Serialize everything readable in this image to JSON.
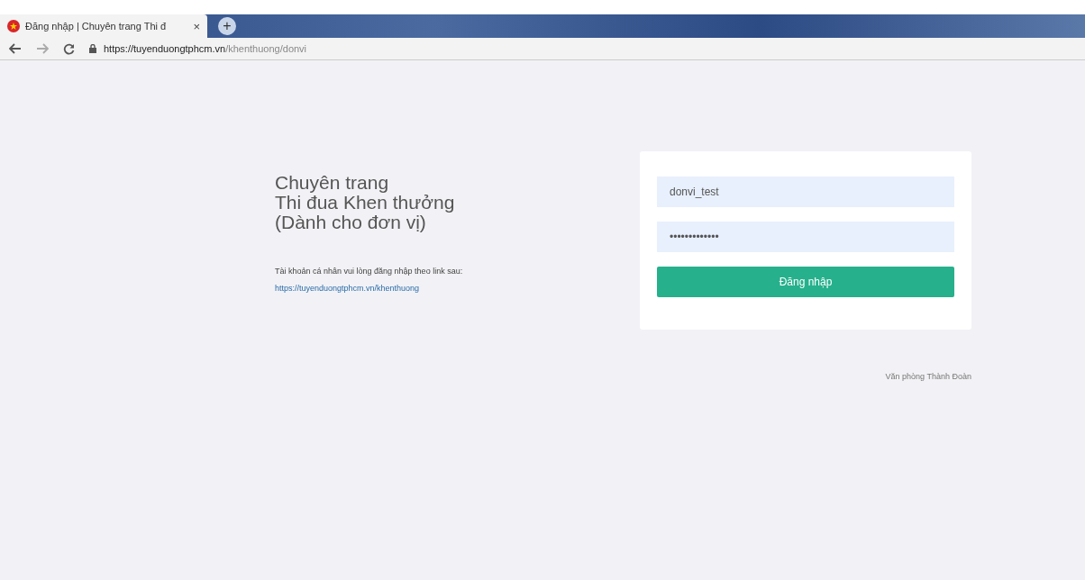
{
  "browser": {
    "tab": {
      "title": "Đăng nhập | Chuyên trang Thi đ",
      "close": "×"
    },
    "new_tab": "+",
    "address": {
      "host": "https://tuyenduongtphcm.vn",
      "path": "/khenthuong/donvi"
    }
  },
  "intro": {
    "heading": [
      "Chuyên trang",
      "Thi đua Khen thưởng",
      "(Dành cho đơn vị)"
    ],
    "note": "Tài khoản cá nhân vui lòng đăng nhập theo link sau:",
    "link": "https://tuyenduongtphcm.vn/khenthuong"
  },
  "login": {
    "username": "donvi_test",
    "password": "•••••••••••••",
    "button": "Đăng nhập"
  },
  "footer": "Văn phòng Thành Đoàn"
}
